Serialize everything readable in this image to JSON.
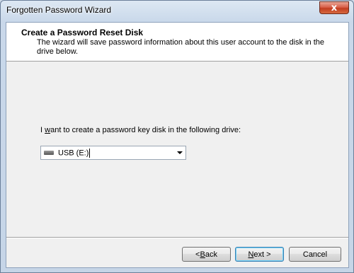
{
  "window": {
    "title": "Forgotten Password Wizard",
    "close_glyph": "x"
  },
  "header": {
    "title": "Create a Password Reset Disk",
    "description": "The wizard will save password information about this user account to the disk in the drive below."
  },
  "main": {
    "prompt_pre": "I ",
    "prompt_accel": "w",
    "prompt_post": "ant to create a password key disk in the following drive:",
    "drive_select": {
      "selected": "USB (E:)",
      "icon": "usb-drive-icon"
    }
  },
  "buttons": {
    "back_pre": "< ",
    "back_accel": "B",
    "back_post": "ack",
    "next_accel": "N",
    "next_post": "ext >",
    "cancel": "Cancel"
  }
}
